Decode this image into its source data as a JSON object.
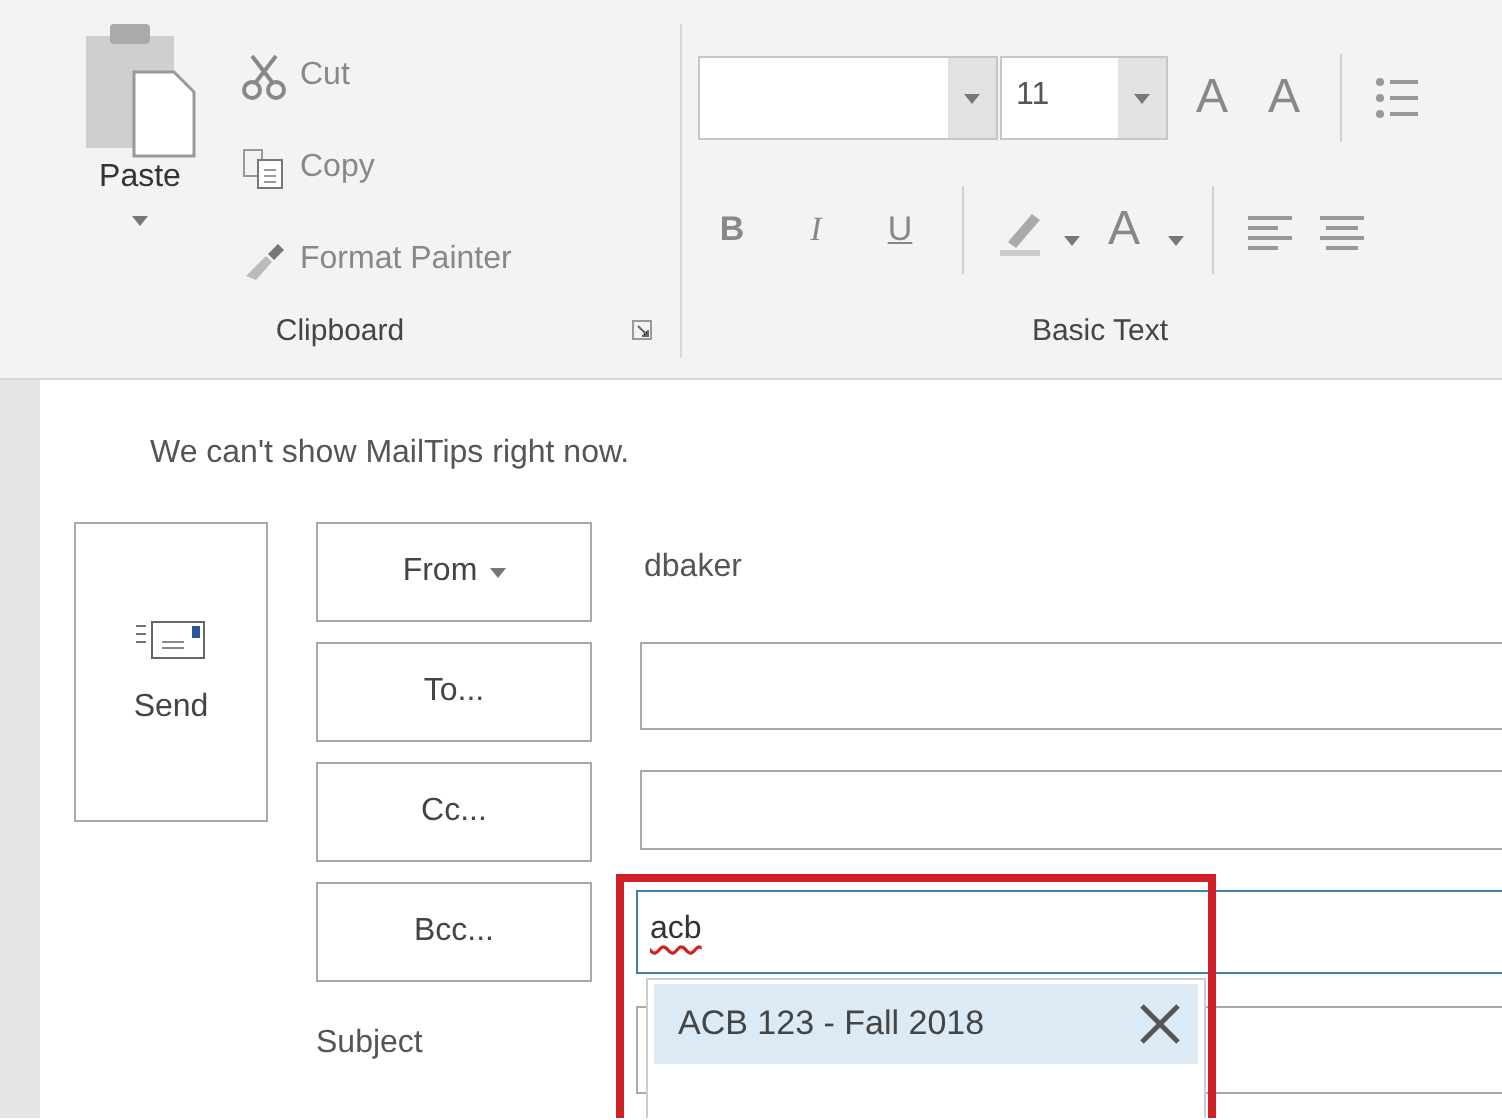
{
  "ribbon": {
    "clipboard": {
      "label": "Clipboard",
      "paste": "Paste",
      "commands": [
        {
          "kind": "cut",
          "label": "Cut",
          "disabled": true
        },
        {
          "kind": "copy",
          "label": "Copy",
          "disabled": true
        },
        {
          "kind": "painter",
          "label": "Format Painter",
          "disabled": true
        }
      ]
    },
    "basic_text": {
      "label": "Basic Text",
      "font_size": "11",
      "grow_font": "A",
      "shrink_font": "A",
      "format_buttons": [
        "B",
        "I",
        "U"
      ],
      "font_color": "A"
    }
  },
  "message": {
    "mailtips": "We can't show MailTips right now.",
    "send": "Send",
    "from": {
      "label": "From",
      "sender": "dbaker"
    },
    "recipients": [
      {
        "label": "To...",
        "focused": false
      },
      {
        "label": "Cc...",
        "focused": false
      },
      {
        "label": "Bcc...",
        "value": "acb",
        "focused": true,
        "misspelled": true
      }
    ],
    "subject": {
      "label": "Subject"
    },
    "suggestions": [
      {
        "label": "ACB 123 - Fall 2018",
        "selected": true
      }
    ],
    "highlight": true
  }
}
